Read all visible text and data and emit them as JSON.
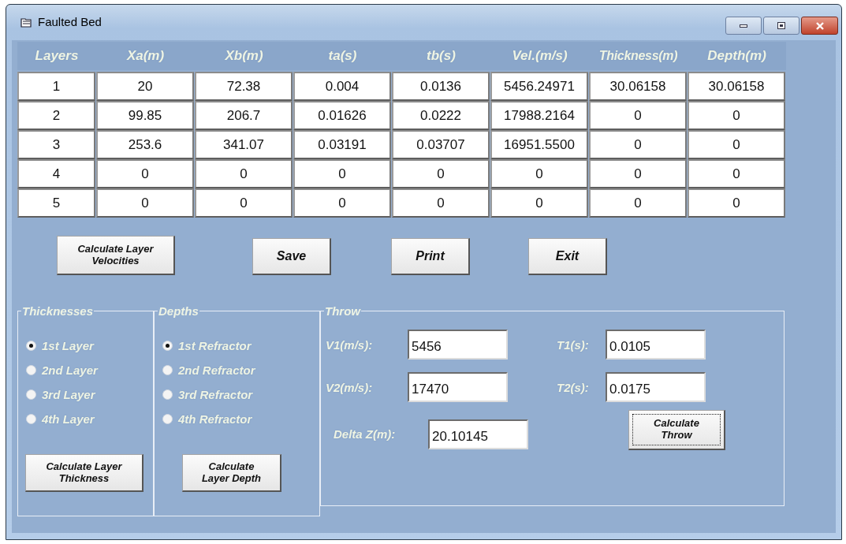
{
  "window": {
    "title": "Faulted Bed"
  },
  "table": {
    "columns": [
      "Layers",
      "Xa(m)",
      "Xb(m)",
      "ta(s)",
      "tb(s)",
      "Vel.(m/s)",
      "Thickness(m)",
      "Depth(m)"
    ],
    "rows": [
      [
        "1",
        "20",
        "72.38",
        "0.004",
        "0.0136",
        "5456.24971",
        "30.06158",
        "30.06158"
      ],
      [
        "2",
        "99.85",
        "206.7",
        "0.01626",
        "0.0222",
        "17988.2164",
        "0",
        "0"
      ],
      [
        "3",
        "253.6",
        "341.07",
        "0.03191",
        "0.03707",
        "16951.5500",
        "0",
        "0"
      ],
      [
        "4",
        "0",
        "0",
        "0",
        "0",
        "0",
        "0",
        "0"
      ],
      [
        "5",
        "0",
        "0",
        "0",
        "0",
        "0",
        "0",
        "0"
      ]
    ]
  },
  "buttons": [
    "Calculate Layer Velocities",
    "Save",
    "Print",
    "Exit"
  ],
  "thicknesses": {
    "title": "Thicknesses",
    "options": [
      {
        "label": "1st Layer",
        "selected": true
      },
      {
        "label": "2nd Layer",
        "selected": false
      },
      {
        "label": "3rd Layer",
        "selected": false
      },
      {
        "label": "4th Layer",
        "selected": false
      }
    ],
    "button": "Calculate Layer Thickness"
  },
  "depths": {
    "title": "Depths",
    "options": [
      {
        "label": "1st Refractor",
        "selected": true
      },
      {
        "label": "2nd Refractor",
        "selected": false
      },
      {
        "label": "3rd Refractor",
        "selected": false
      },
      {
        "label": "4th Refractor",
        "selected": false
      }
    ],
    "button": "Calculate Layer Depth"
  },
  "throw": {
    "title": "Throw",
    "fields": [
      {
        "label": "V1(m/s):",
        "value": "5456"
      },
      {
        "label": "T1(s):",
        "value": "0.0105"
      },
      {
        "label": "V2(m/s):",
        "value": "17470"
      },
      {
        "label": "T2(s):",
        "value": "0.0175"
      }
    ],
    "delta": {
      "label": "Delta Z(m):",
      "value": "20.10145"
    },
    "button": {
      "label": "Calculate Throw",
      "focused": true
    }
  }
}
